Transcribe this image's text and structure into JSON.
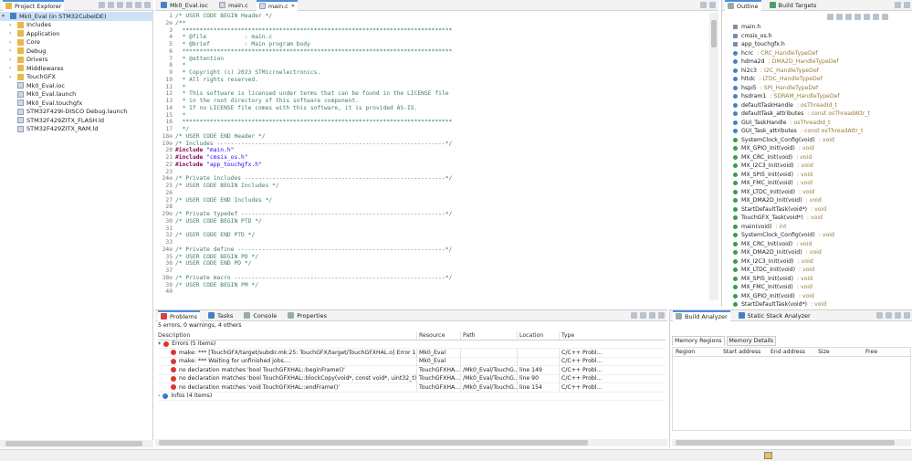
{
  "project_explorer": {
    "tab_label": "Project Explorer",
    "root": "Mk0_Eval (in STM32CubeIDE)",
    "items": [
      {
        "label": "Includes",
        "kind": "folder"
      },
      {
        "label": "Application",
        "kind": "folder"
      },
      {
        "label": "Core",
        "kind": "folder"
      },
      {
        "label": "Debug",
        "kind": "folder"
      },
      {
        "label": "Drivers",
        "kind": "folder"
      },
      {
        "label": "Middlewares",
        "kind": "folder"
      },
      {
        "label": "TouchGFX",
        "kind": "folder"
      },
      {
        "label": "Mk0_Eval.ioc",
        "kind": "file"
      },
      {
        "label": "Mk0_Eval.launch",
        "kind": "file"
      },
      {
        "label": "Mk0_Eval.touchgfx",
        "kind": "file"
      },
      {
        "label": "STM32F429I-DISCO Debug.launch",
        "kind": "file"
      },
      {
        "label": "STM32F429ZITX_FLASH.ld",
        "kind": "file"
      },
      {
        "label": "STM32F429ZITX_RAM.ld",
        "kind": "file"
      }
    ]
  },
  "editor": {
    "tabs": [
      {
        "label": "Mk0_Eval.ioc"
      },
      {
        "label": "main.c"
      },
      {
        "label": "main.c"
      }
    ],
    "lines": [
      {
        "n": "1",
        "t": "/* USER CODE BEGIN Header */",
        "k": "c"
      },
      {
        "n": "2⊖",
        "t": "/**",
        "k": "c"
      },
      {
        "n": "3",
        "t": "  ******************************************************************************",
        "k": "c"
      },
      {
        "n": "4",
        "t": "  * @file           : main.c",
        "k": "c"
      },
      {
        "n": "5",
        "t": "  * @brief          : Main program body",
        "k": "c"
      },
      {
        "n": "6",
        "t": "  ******************************************************************************",
        "k": "c"
      },
      {
        "n": "7",
        "t": "  * @attention",
        "k": "c"
      },
      {
        "n": "8",
        "t": "  *",
        "k": "c"
      },
      {
        "n": "9",
        "t": "  * Copyright (c) 2023 STMicroelectronics.",
        "k": "c"
      },
      {
        "n": "10",
        "t": "  * All rights reserved.",
        "k": "c"
      },
      {
        "n": "11",
        "t": "  *",
        "k": "c"
      },
      {
        "n": "12",
        "t": "  * This software is licensed under terms that can be found in the LICENSE file",
        "k": "c"
      },
      {
        "n": "13",
        "t": "  * in the root directory of this software component.",
        "k": "c"
      },
      {
        "n": "14",
        "t": "  * If no LICENSE file comes with this software, it is provided AS-IS.",
        "k": "c"
      },
      {
        "n": "15",
        "t": "  *",
        "k": "c"
      },
      {
        "n": "16",
        "t": "  ******************************************************************************",
        "k": "c"
      },
      {
        "n": "17",
        "t": "  */",
        "k": "c"
      },
      {
        "n": "18⊖",
        "t": "/* USER CODE END Header */",
        "k": "c"
      },
      {
        "n": "19⊖",
        "t": "/* Includes ------------------------------------------------------------------*/",
        "k": "c"
      },
      {
        "n": "20",
        "t": "#include \"main.h\"",
        "k": "i"
      },
      {
        "n": "21",
        "t": "#include \"cmsis_os.h\"",
        "k": "i"
      },
      {
        "n": "22",
        "t": "#include \"app_touchgfx.h\"",
        "k": "i"
      },
      {
        "n": "23",
        "t": "",
        "k": "c"
      },
      {
        "n": "24⊖",
        "t": "/* Private includes ----------------------------------------------------------*/",
        "k": "c"
      },
      {
        "n": "25",
        "t": "/* USER CODE BEGIN Includes */",
        "k": "c"
      },
      {
        "n": "26",
        "t": "",
        "k": "c"
      },
      {
        "n": "27",
        "t": "/* USER CODE END Includes */",
        "k": "c"
      },
      {
        "n": "28",
        "t": "",
        "k": "c"
      },
      {
        "n": "29⊖",
        "t": "/* Private typedef -----------------------------------------------------------*/",
        "k": "c"
      },
      {
        "n": "30",
        "t": "/* USER CODE BEGIN PTD */",
        "k": "c"
      },
      {
        "n": "31",
        "t": "",
        "k": "c"
      },
      {
        "n": "32",
        "t": "/* USER CODE END PTD */",
        "k": "c"
      },
      {
        "n": "33",
        "t": "",
        "k": "c"
      },
      {
        "n": "34⊖",
        "t": "/* Private define ------------------------------------------------------------*/",
        "k": "c"
      },
      {
        "n": "35",
        "t": "/* USER CODE BEGIN PD */",
        "k": "c"
      },
      {
        "n": "36",
        "t": "/* USER CODE END PD */",
        "k": "c"
      },
      {
        "n": "37",
        "t": "",
        "k": "c"
      },
      {
        "n": "38⊖",
        "t": "/* Private macro -------------------------------------------------------------*/",
        "k": "c"
      },
      {
        "n": "39",
        "t": "/* USER CODE BEGIN PM */",
        "k": "c"
      },
      {
        "n": "40",
        "t": "",
        "k": "c"
      }
    ]
  },
  "outline": {
    "tabs": [
      {
        "label": "Outline"
      },
      {
        "label": "Build Targets"
      }
    ],
    "items": [
      {
        "name": "main.h",
        "type": "",
        "kind": "inc"
      },
      {
        "name": "cmsis_os.h",
        "type": "",
        "kind": "inc"
      },
      {
        "name": "app_touchgfx.h",
        "type": "",
        "kind": "inc"
      },
      {
        "name": "hcrc",
        "type": " : CRC_HandleTypeDef",
        "kind": "field"
      },
      {
        "name": "hdma2d",
        "type": " : DMA2D_HandleTypeDef",
        "kind": "field"
      },
      {
        "name": "hi2c3",
        "type": " : I2C_HandleTypeDef",
        "kind": "field"
      },
      {
        "name": "hltdc",
        "type": " : LTDC_HandleTypeDef",
        "kind": "field"
      },
      {
        "name": "hspi5",
        "type": " : SPI_HandleTypeDef",
        "kind": "field"
      },
      {
        "name": "hsdram1",
        "type": " : SDRAM_HandleTypeDef",
        "kind": "field"
      },
      {
        "name": "defaultTaskHandle",
        "type": " : osThreadId_t",
        "kind": "field"
      },
      {
        "name": "defaultTask_attributes",
        "type": " : const osThreadAttr_t",
        "kind": "field"
      },
      {
        "name": "GUI_TaskHandle",
        "type": " : osThreadId_t",
        "kind": "field"
      },
      {
        "name": "GUI_Task_attributes",
        "type": " : const osThreadAttr_t",
        "kind": "field"
      },
      {
        "name": "SystemClock_Config(void)",
        "type": " : void",
        "kind": "func"
      },
      {
        "name": "MX_GPIO_Init(void)",
        "type": " : void",
        "kind": "func"
      },
      {
        "name": "MX_CRC_Init(void)",
        "type": " : void",
        "kind": "func"
      },
      {
        "name": "MX_I2C3_Init(void)",
        "type": " : void",
        "kind": "func"
      },
      {
        "name": "MX_SPI5_Init(void)",
        "type": " : void",
        "kind": "func"
      },
      {
        "name": "MX_FMC_Init(void)",
        "type": " : void",
        "kind": "func"
      },
      {
        "name": "MX_LTDC_Init(void)",
        "type": " : void",
        "kind": "func"
      },
      {
        "name": "MX_DMA2D_Init(void)",
        "type": " : void",
        "kind": "func"
      },
      {
        "name": "StartDefaultTask(void*)",
        "type": " : void",
        "kind": "func"
      },
      {
        "name": "TouchGFX_Task(void*)",
        "type": " : void",
        "kind": "func"
      },
      {
        "name": "main(void)",
        "type": " : int",
        "kind": "func"
      },
      {
        "name": "SystemClock_Config(void)",
        "type": " : void",
        "kind": "func"
      },
      {
        "name": "MX_CRC_Init(void)",
        "type": " : void",
        "kind": "func"
      },
      {
        "name": "MX_DMA2D_Init(void)",
        "type": " : void",
        "kind": "func"
      },
      {
        "name": "MX_I2C3_Init(void)",
        "type": " : void",
        "kind": "func"
      },
      {
        "name": "MX_LTDC_Init(void)",
        "type": " : void",
        "kind": "func"
      },
      {
        "name": "MX_SPI5_Init(void)",
        "type": " : void",
        "kind": "func"
      },
      {
        "name": "MX_FMC_Init(void)",
        "type": " : void",
        "kind": "func"
      },
      {
        "name": "MX_GPIO_Init(void)",
        "type": " : void",
        "kind": "func"
      },
      {
        "name": "StartDefaultTask(void*)",
        "type": " : void",
        "kind": "func"
      }
    ]
  },
  "problems": {
    "tabs": [
      {
        "label": "Problems"
      },
      {
        "label": "Tasks"
      },
      {
        "label": "Console"
      },
      {
        "label": "Properties"
      }
    ],
    "summary": "5 errors, 0 warnings, 4 others",
    "columns": [
      "Description",
      "Resource",
      "Path",
      "Location",
      "Type"
    ],
    "groups": [
      {
        "label": "Errors (5 items)",
        "kind": "error"
      },
      {
        "label": "Infos (4 items)",
        "kind": "info"
      }
    ],
    "errors": [
      {
        "desc": "make: *** [TouchGFX/target/subdir.mk:25: TouchGFX/target/TouchGFXHAL.o] Error 1",
        "resource": "Mk0_Eval",
        "path": "",
        "location": "",
        "type": "C/C++ Probl..."
      },
      {
        "desc": "make: *** Waiting for unfinished jobs....",
        "resource": "Mk0_Eval",
        "path": "",
        "location": "",
        "type": "C/C++ Probl..."
      },
      {
        "desc": "no declaration matches 'bool TouchGFXHAL::beginFrame()'",
        "resource": "TouchGFXHA...",
        "path": "/Mk0_Eval/TouchG...",
        "location": "line 149",
        "type": "C/C++ Probl..."
      },
      {
        "desc": "no declaration matches 'bool TouchGFXHAL::blockCopy(void*, const void*, uint32_t)'",
        "resource": "TouchGFXHA...",
        "path": "/Mk0_Eval/TouchG...",
        "location": "line 90",
        "type": "C/C++ Probl..."
      },
      {
        "desc": "no declaration matches 'void TouchGFXHAL::endFrame()'",
        "resource": "TouchGFXHA...",
        "path": "/Mk0_Eval/TouchG...",
        "location": "line 154",
        "type": "C/C++ Probl..."
      }
    ]
  },
  "build_analyzer": {
    "tabs": [
      {
        "label": "Build Analyzer"
      },
      {
        "label": "Static Stack Analyzer"
      }
    ],
    "subtabs": [
      {
        "label": "Memory Regions"
      },
      {
        "label": "Memory Details"
      }
    ],
    "columns": [
      "Region",
      "Start address",
      "End address",
      "Size",
      "Free"
    ]
  }
}
